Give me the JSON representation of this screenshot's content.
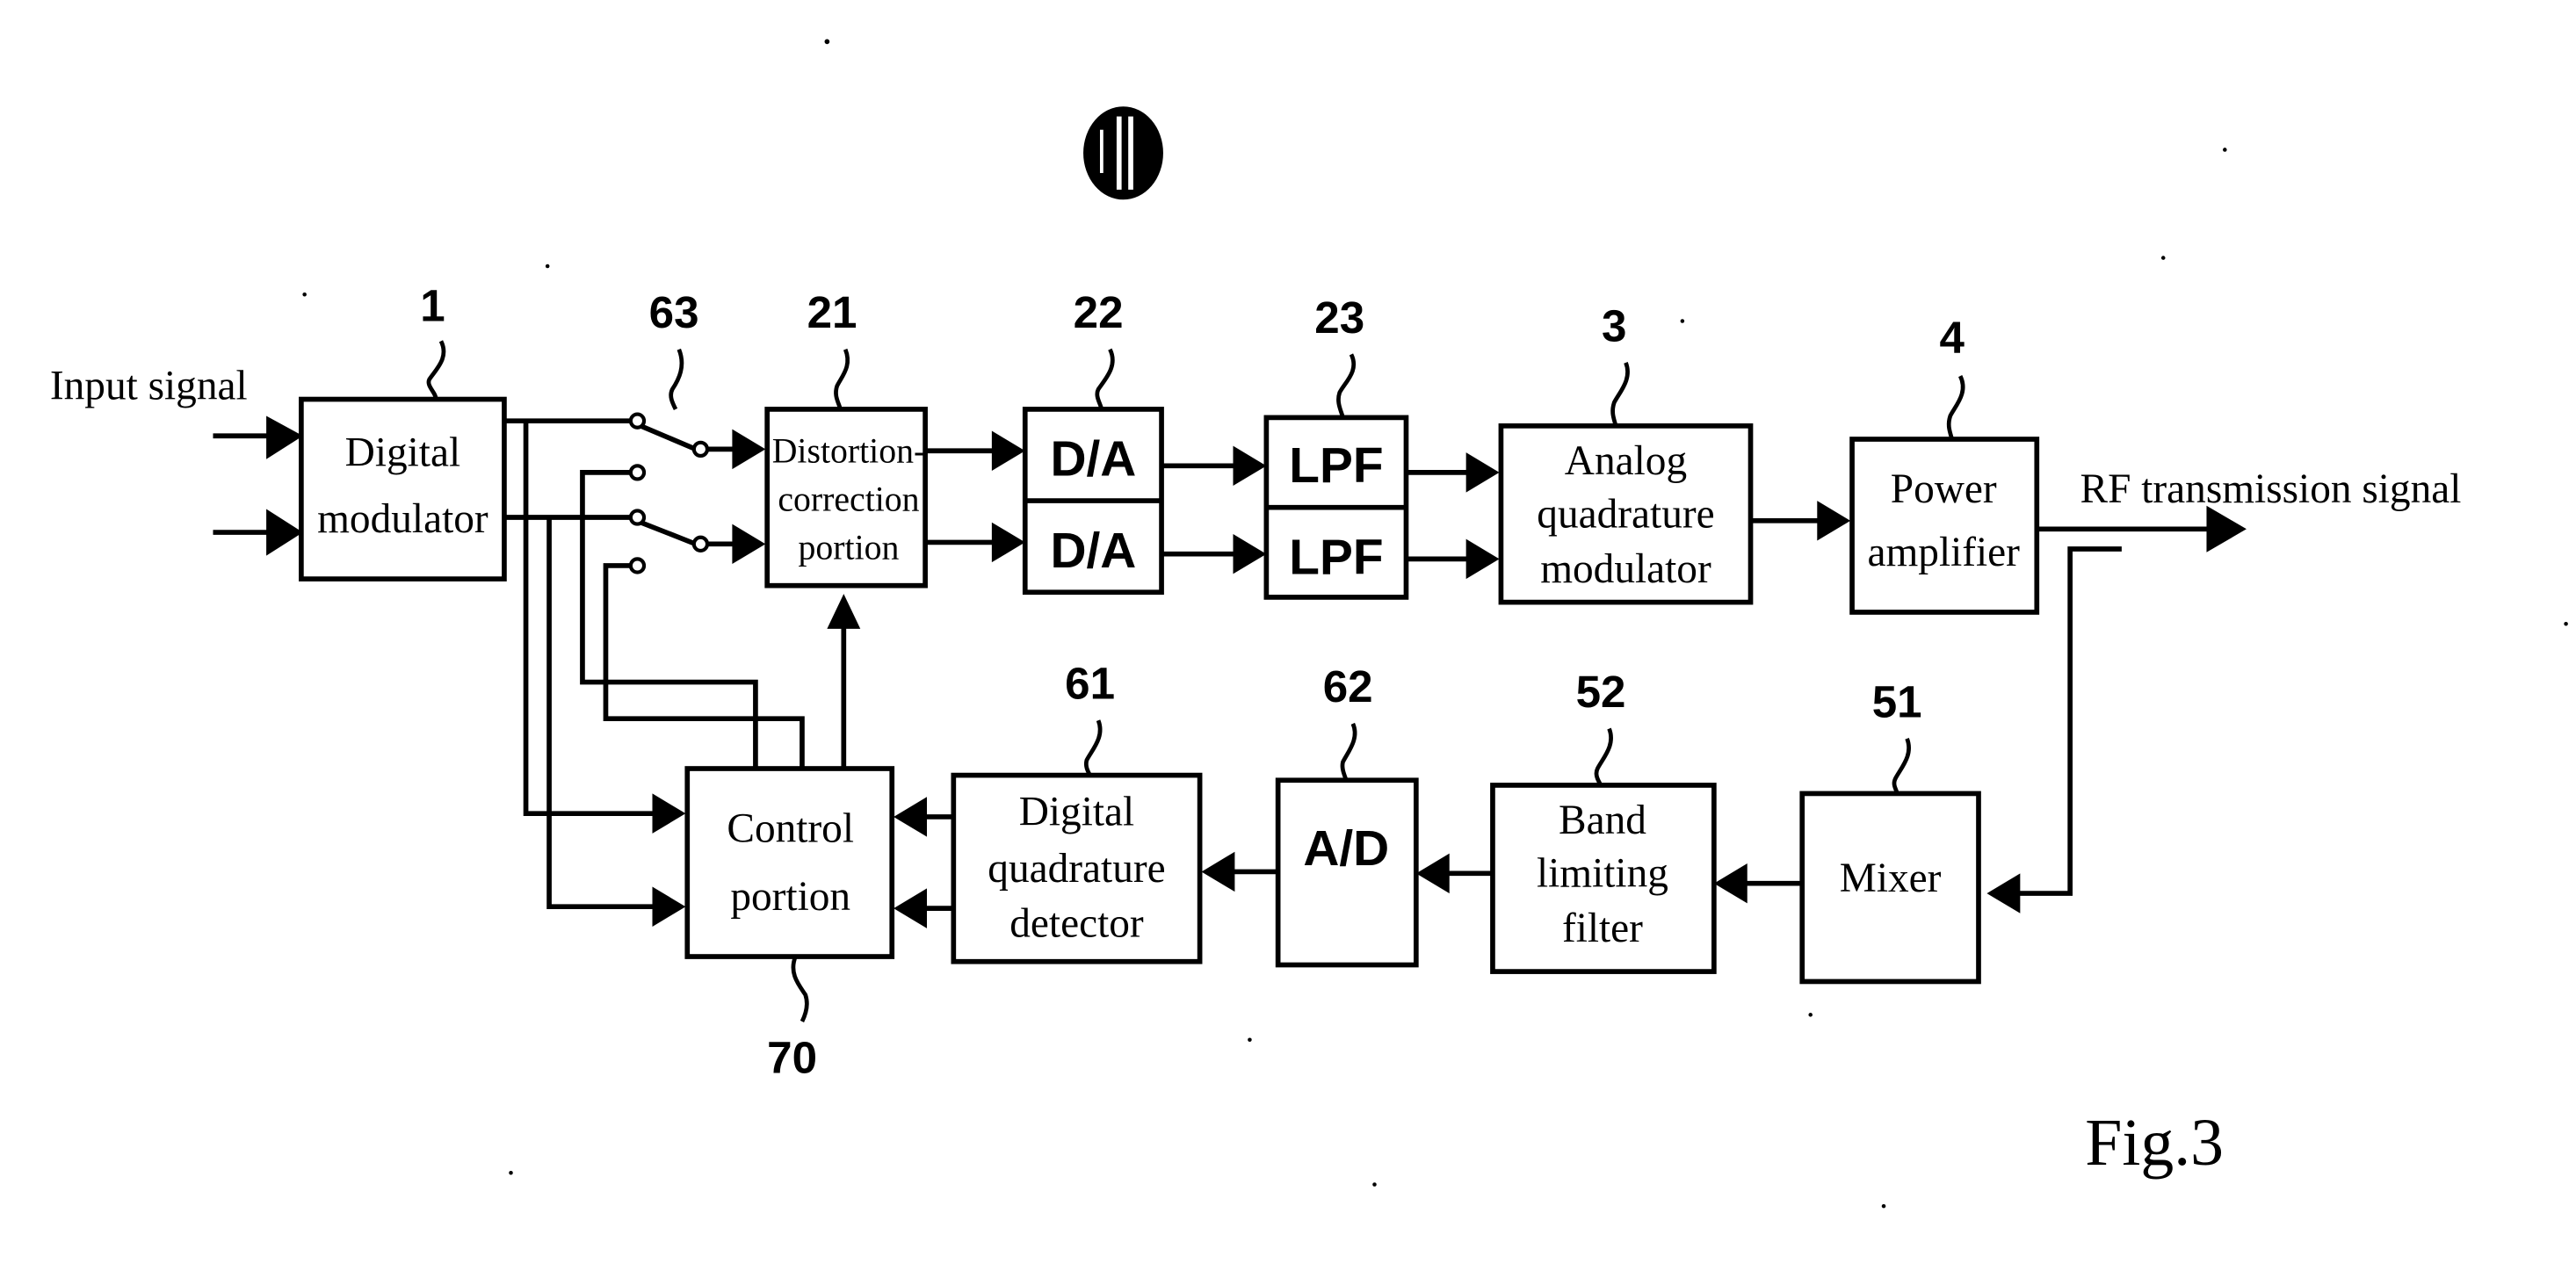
{
  "figure": {
    "label": "Fig.3"
  },
  "signals": {
    "input": "Input signal",
    "output": "RF transmission signal"
  },
  "blocks": {
    "digital_modulator": {
      "ref": "1",
      "lines": [
        "Digital",
        "modulator"
      ]
    },
    "switch": {
      "ref": "63"
    },
    "distortion_correction": {
      "ref": "21",
      "lines": [
        "Distortion-",
        "correction",
        "portion"
      ]
    },
    "da": {
      "ref": "22",
      "labels": [
        "D/A",
        "D/A"
      ]
    },
    "lpf": {
      "ref": "23",
      "labels": [
        "LPF",
        "LPF"
      ]
    },
    "analog_quadrature_modulator": {
      "ref": "3",
      "lines": [
        "Analog",
        "quadrature",
        "modulator"
      ]
    },
    "power_amplifier": {
      "ref": "4",
      "lines": [
        "Power",
        "amplifier"
      ]
    },
    "mixer": {
      "ref": "51",
      "lines": [
        "Mixer"
      ]
    },
    "band_limiting_filter": {
      "ref": "52",
      "lines": [
        "Band",
        "limiting",
        "filter"
      ]
    },
    "ad": {
      "ref": "62",
      "label": "A/D"
    },
    "digital_quadrature_detector": {
      "ref": "61",
      "lines": [
        "Digital",
        "quadrature",
        "detector"
      ]
    },
    "control_portion": {
      "ref": "70",
      "lines": [
        "Control",
        "portion"
      ]
    }
  }
}
